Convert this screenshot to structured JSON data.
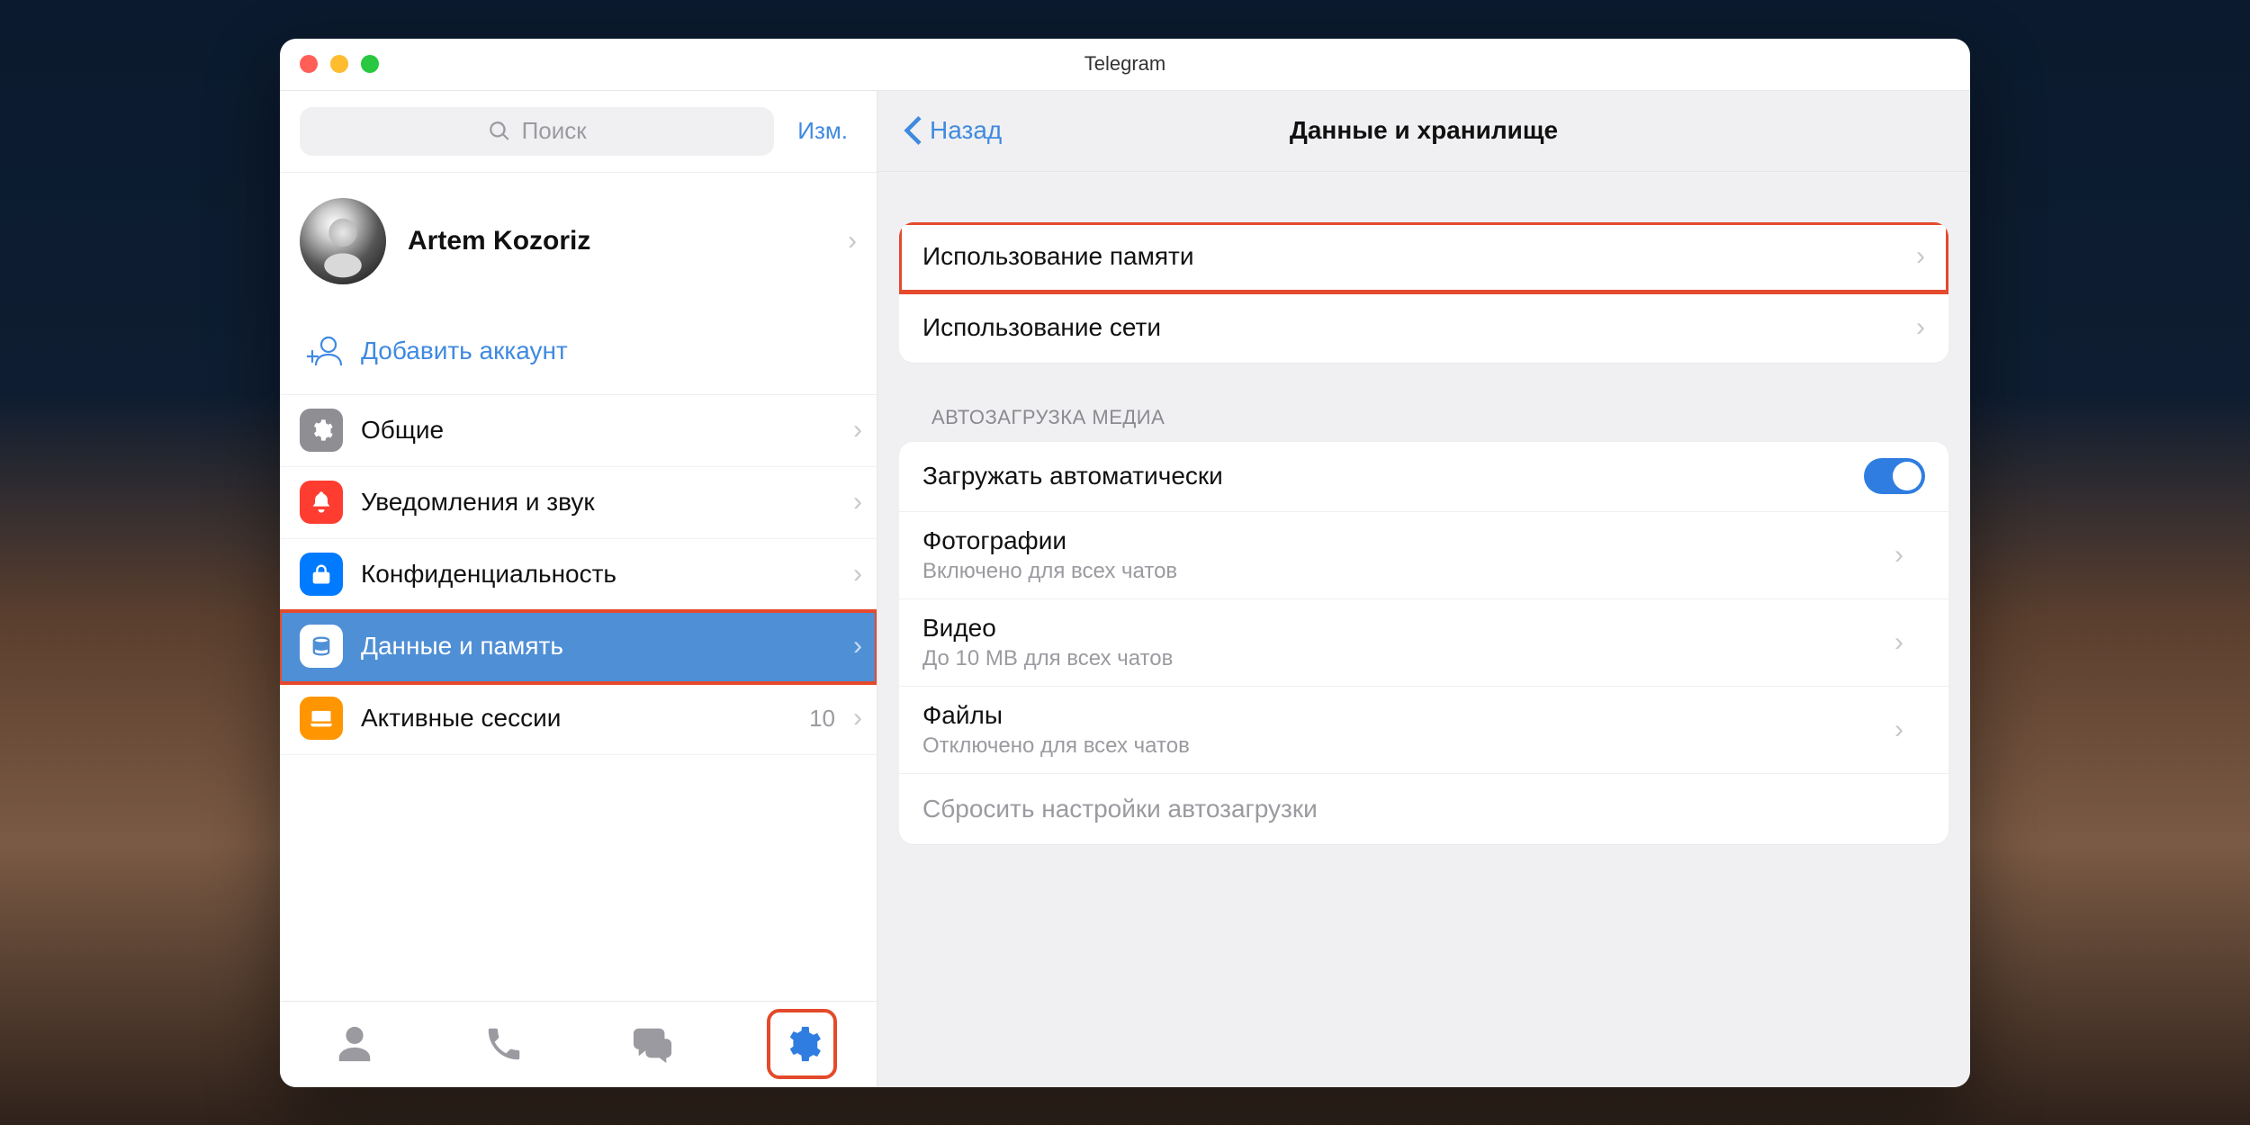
{
  "window": {
    "title": "Telegram"
  },
  "sidebar": {
    "search_placeholder": "Поиск",
    "edit_label": "Изм.",
    "profile_name": "Artem Kozoriz",
    "add_account_label": "Добавить аккаунт",
    "items": [
      {
        "label": "Общие",
        "icon": "gear",
        "color": "#8e8e93"
      },
      {
        "label": "Уведомления и звук",
        "icon": "bell",
        "color": "#fe3c30"
      },
      {
        "label": "Конфиденциальность",
        "icon": "lock",
        "color": "#007aff"
      },
      {
        "label": "Данные и память",
        "icon": "storage",
        "color": "#ffffff",
        "selected": true
      },
      {
        "label": "Активные сессии",
        "icon": "laptop",
        "color": "#ff9500",
        "value": "10"
      }
    ]
  },
  "main": {
    "back_label": "Назад",
    "title": "Данные и хранилище",
    "usage": [
      {
        "label": "Использование памяти",
        "highlight": true
      },
      {
        "label": "Использование сети"
      }
    ],
    "auto_header": "АВТОЗАГРУЗКА МЕДИА",
    "auto": {
      "toggle_label": "Загружать автоматически",
      "toggle_on": true,
      "rows": [
        {
          "label": "Фотографии",
          "sub": "Включено для всех чатов"
        },
        {
          "label": "Видео",
          "sub": "До 10 MB для всех чатов"
        },
        {
          "label": "Файлы",
          "sub": "Отключено для всех чатов"
        }
      ],
      "reset_label": "Сбросить настройки автозагрузки"
    }
  },
  "colors": {
    "accent": "#3f8ae0",
    "highlight": "#e44a2b"
  }
}
